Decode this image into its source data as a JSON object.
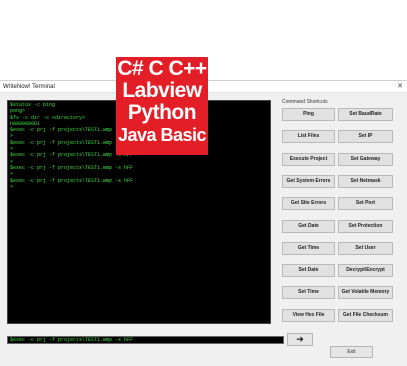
{
  "window": {
    "title": "WriteNow! Terminal",
    "close_glyph": "✕"
  },
  "terminal": {
    "lines": [
      "$status -c ping",
      "pong>",
      "$fs -c dir -c <directory>",
      "h800000001",
      "$exec -c prj -f projects\\TEST1.wmp -s hFF",
      ">",
      "$exec -c prj -f projects\\TEST1.wmp -s hFF",
      ">",
      "$exec -c prj -f projects\\TEST1.wmp -s hFF",
      ">",
      "$exec -c prj -f projects\\TEST1.wmp -s hFF",
      ">",
      "$exec -c prj -f projects\\TEST1.wmp -s hFF",
      ">"
    ]
  },
  "command_input": {
    "value": "$exec -c prj -f projects\\TEST1.wmp -s hFF"
  },
  "send_button": {
    "icon": "arrow-right-icon",
    "glyph": "➔"
  },
  "exit_button": {
    "label": "Exit"
  },
  "shortcuts": {
    "label": "Command Shortcuts",
    "rows": [
      [
        "Ping",
        "Set BaudRate"
      ],
      [
        "List Files",
        "Set IP"
      ],
      [
        "Execute Project",
        "Set Gateway"
      ],
      [
        "Get System Errors",
        "Set Netmask"
      ],
      [
        "Get Site Errors",
        "Set Port"
      ],
      [
        "Get Date",
        "Set Protection"
      ],
      [
        "Get Time",
        "Set User"
      ],
      [
        "Set Date",
        "Decrypt/Encrypt"
      ],
      [
        "Set Time",
        "Get Volatile Memory"
      ],
      [
        "View Hex File",
        "Get File Checksum"
      ]
    ]
  },
  "banner": {
    "lines": [
      "C# C C++",
      "Labview",
      "Python",
      "Java Basic"
    ],
    "color": "#e41e26"
  },
  "colors": {
    "terminal_bg": "#000000",
    "terminal_text": "#3ee03e",
    "window_bg": "#f0f0f0"
  }
}
